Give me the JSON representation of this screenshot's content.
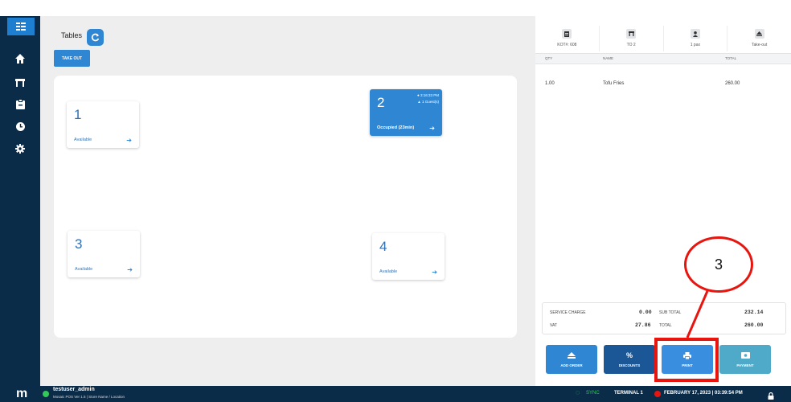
{
  "nav": {
    "items": [
      {
        "icon": "menu-grid-icon"
      },
      {
        "icon": "home-icon"
      },
      {
        "icon": "dining-table-icon"
      },
      {
        "icon": "clipboard-icon"
      },
      {
        "icon": "clock-icon"
      },
      {
        "icon": "gear-icon"
      }
    ]
  },
  "main": {
    "title": "Tables",
    "refresh_icon": "refresh-icon",
    "takeout_label": "TAKE OUT",
    "tables": [
      {
        "number": "1",
        "status": "Available"
      },
      {
        "number": "2",
        "status": "Occupied (23min)",
        "time": "3:16:33 PM",
        "guests": "1 Guest(s)"
      },
      {
        "number": "3",
        "status": "Available"
      },
      {
        "number": "4",
        "status": "Available"
      }
    ]
  },
  "order": {
    "tabs": [
      {
        "label": "KOT#: 608",
        "icon": "receipt-icon"
      },
      {
        "label": "TO 2",
        "icon": "table-icon"
      },
      {
        "label": "1 pax",
        "icon": "person-icon"
      },
      {
        "label": "Take-out",
        "icon": "eject-icon"
      }
    ],
    "columns": {
      "qty": "QTY",
      "name": "NAME",
      "total": "TOTAL"
    },
    "items": [
      {
        "qty": "1.00",
        "name": "Tofu Fries",
        "total": "260.00"
      }
    ],
    "summary": {
      "service_charge_label": "SERVICE CHARGE",
      "service_charge": "0.00",
      "subtotal_label": "SUB TOTAL",
      "subtotal": "232.14",
      "vat_label": "VAT",
      "vat": "27.86",
      "total_label": "TOTAL",
      "total": "260.00"
    },
    "actions": {
      "add_order": "ADD ORDER",
      "discounts": "DISCOUNTS",
      "print": "PRINT",
      "payment": "PAYMENT"
    }
  },
  "annotation": {
    "step_number": "3",
    "color": "#e8150f"
  },
  "footer": {
    "logo": "m",
    "username": "testuser_admin",
    "version": "Mosaic POS Ver 1.5 | Store Name / Location",
    "sync": "SYNC",
    "terminal": "TERMINAL 1",
    "datetime": "FEBRUARY 17, 2023 | 03:39:54 PM"
  },
  "colors": {
    "nav_bg": "#0b2c49",
    "accent_blue": "#2f86d3",
    "add_order": "#2f86d3",
    "discounts": "#1b5797",
    "print": "#3a8ee0",
    "payment": "#4fa9c9",
    "online_green": "#34c759",
    "alert_red": "#e8150f"
  }
}
